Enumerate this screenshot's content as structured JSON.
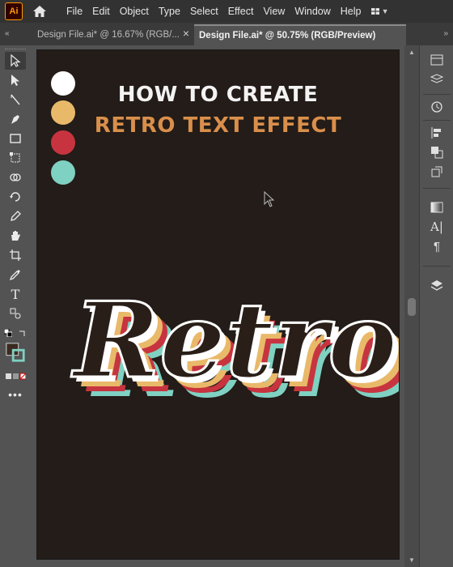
{
  "app": {
    "logo_text": "Ai",
    "brand_color": "#ff9a00"
  },
  "menu": {
    "items": [
      "File",
      "Edit",
      "Object",
      "Type",
      "Select",
      "Effect",
      "View",
      "Window",
      "Help"
    ]
  },
  "tabs": [
    {
      "label": "Design File.ai* @ 16.67% (RGB/...",
      "active": false
    },
    {
      "label": "Design File.ai* @ 50.75% (RGB/Preview)",
      "active": true
    }
  ],
  "artboard": {
    "background": "#231c18",
    "heading_line1": "HOW TO CREATE",
    "heading_line2": "RETRO TEXT EFFECT",
    "artwork_word": "Retro",
    "palette": [
      "#ffffff",
      "#e9b96a",
      "#c7343f",
      "#7fd1c2"
    ],
    "heading2_color": "#d98f4b"
  }
}
